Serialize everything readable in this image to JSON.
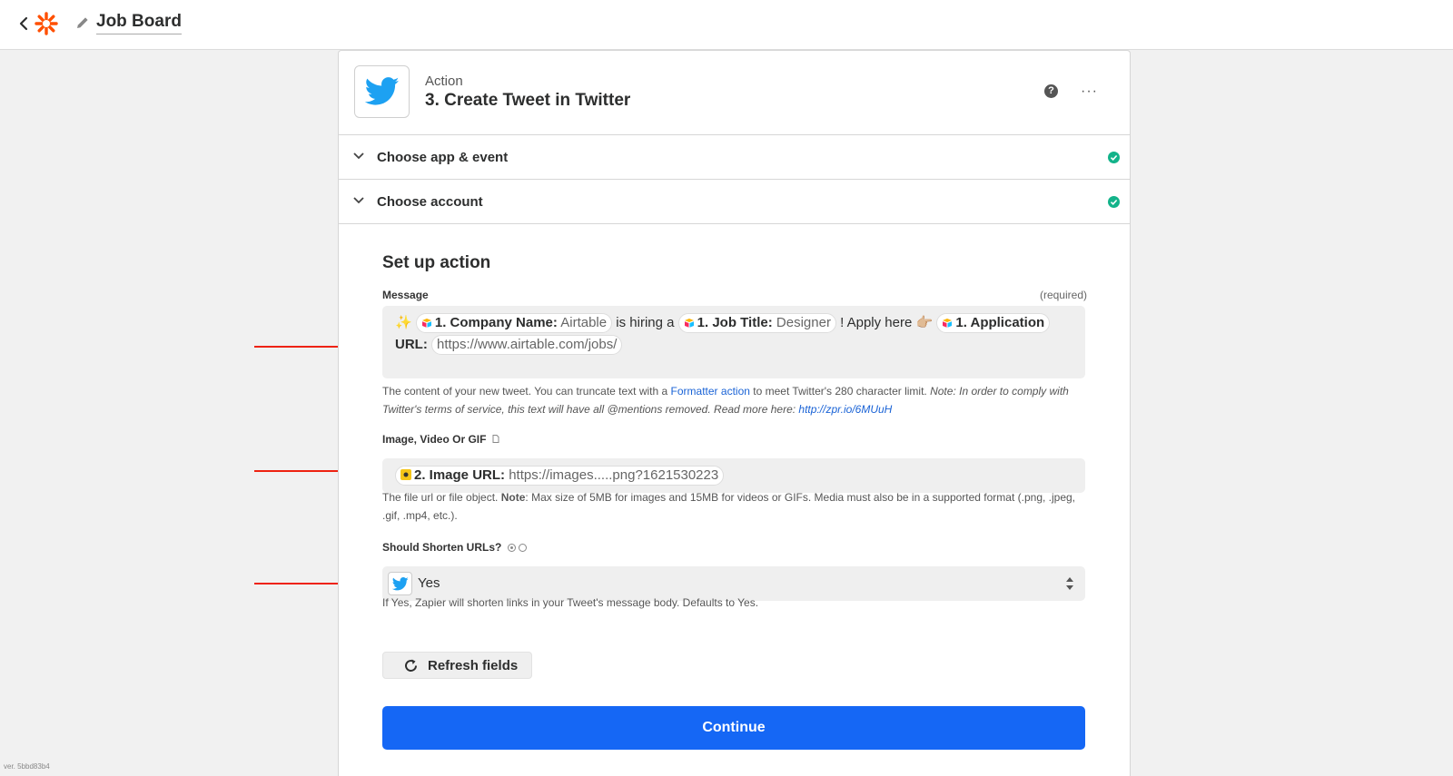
{
  "topbar": {
    "title": "Job Board"
  },
  "version": "ver. 5bbd83b4",
  "step": {
    "kind": "Action",
    "name": "3. Create Tweet in Twitter",
    "help_icon": "?",
    "more_icon": "···"
  },
  "sections": [
    {
      "label": "Choose app & event",
      "complete": true
    },
    {
      "label": "Choose account",
      "complete": true
    }
  ],
  "setup": {
    "title": "Set up action",
    "message": {
      "label": "Message",
      "required_text": "(required)",
      "sparkle": "✨",
      "pill1_key": "1. Company Name:",
      "pill1_val": "Airtable",
      "text1": "is hiring a",
      "pill2_key": "1. Job Title:",
      "pill2_val": "Designer",
      "text2": "! Apply here",
      "pointing_emoji": "👉🏼",
      "pill3_key": "1. Application",
      "pill3_key2": "URL:",
      "pill3_val": "https://www.airtable.com/jobs/",
      "help_a": "The content of your new tweet. You can truncate text with a",
      "help_link1": "Formatter action",
      "help_b": "to meet Twitter's 280 character limit.",
      "help_note": "Note: In order to comply with Twitter's terms of service, this text will have all @mentions removed. Read more here:",
      "help_link2": "http://zpr.io/6MUuH"
    },
    "image": {
      "label": "Image, Video Or GIF",
      "pill_key": "2. Image URL:",
      "pill_val": "https://images.....png?1621530223",
      "help_a": "The file url or file object.",
      "help_note_label": "Note",
      "help_b": ": Max size of 5MB for images and 15MB for videos or GIFs. Media must also be in a supported format (.png, .jpeg, .gif, .mp4, etc.)."
    },
    "shorten": {
      "label": "Should Shorten URLs?",
      "value": "Yes",
      "help": "If Yes, Zapier will shorten links in your Tweet's message body. Defaults to Yes."
    },
    "refresh_label": "Refresh fields",
    "continue_label": "Continue"
  },
  "colors": {
    "zapier_orange": "#ff4f00",
    "twitter_blue": "#1da1f2",
    "continue_blue": "#1567f5",
    "check_teal": "#13b38a",
    "arrow_red": "#ee2211"
  }
}
